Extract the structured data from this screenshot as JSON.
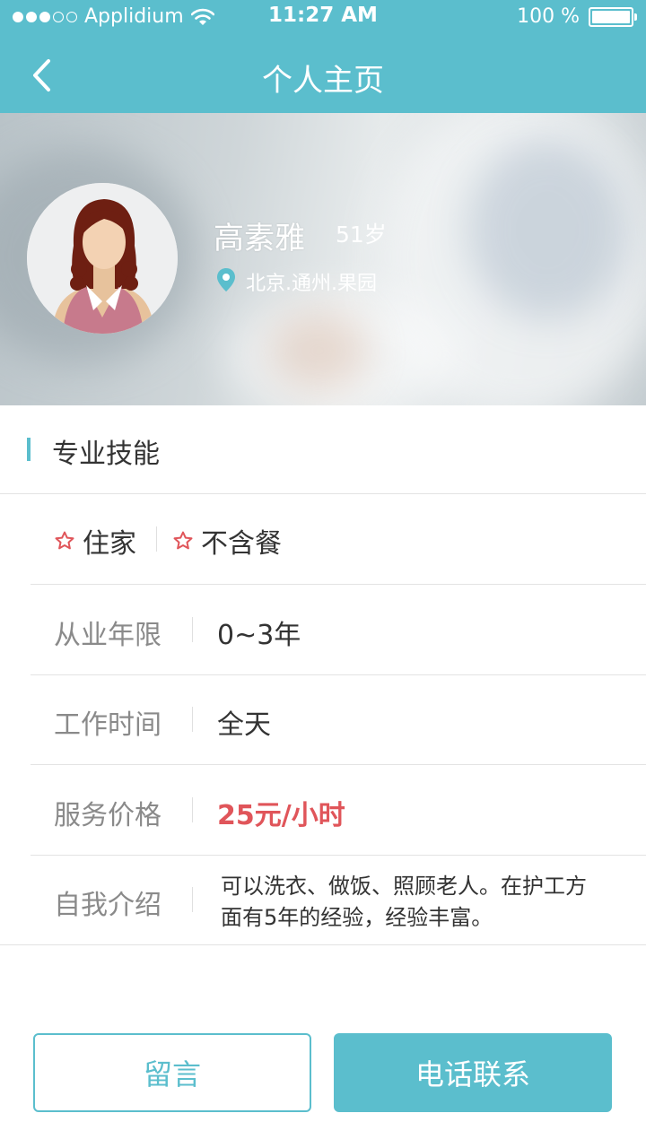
{
  "status_bar": {
    "carrier": "Applidium",
    "time": "11:27 AM",
    "battery": "100 %"
  },
  "nav": {
    "title": "个人主页"
  },
  "profile": {
    "name": "高素雅",
    "age": "51岁",
    "location": "北京.通州.果园"
  },
  "section": {
    "title": "专业技能"
  },
  "skills": [
    "住家",
    "不含餐"
  ],
  "details": {
    "experience_label": "从业年限",
    "experience_value": "0~3年",
    "work_time_label": "工作时间",
    "work_time_value": "全天",
    "price_label": "服务价格",
    "price_value": "25元/小时",
    "intro_label": "自我介绍",
    "intro_value": "可以洗衣、做饭、照顾老人。在护工方面有5年的经验，经验丰富。"
  },
  "actions": {
    "message_label": "留言",
    "call_label": "电话联系"
  },
  "colors": {
    "accent": "#5bbecd",
    "price": "#e0555a"
  }
}
